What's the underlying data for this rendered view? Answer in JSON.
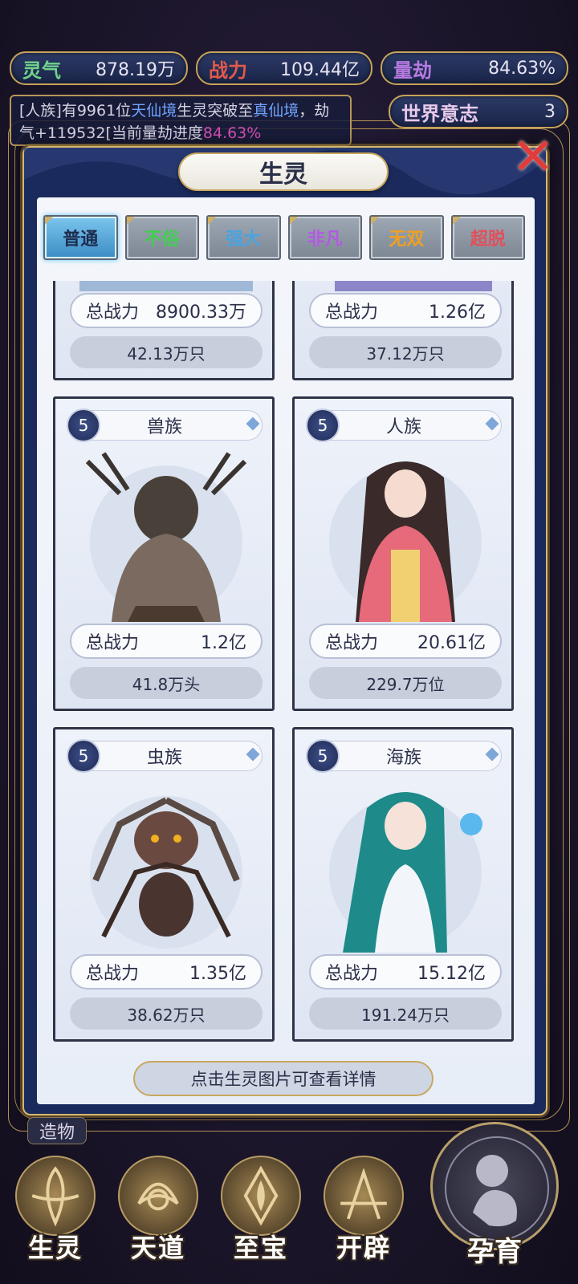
{
  "resources": {
    "qi": {
      "label": "灵气",
      "value": "878.19万"
    },
    "power": {
      "label": "战力",
      "value": "109.44亿"
    },
    "kalpa": {
      "label": "量劫",
      "value": "84.63%"
    },
    "world_will": {
      "label": "世界意志",
      "value": "3"
    }
  },
  "news": {
    "prefix": "[人族]有9961位",
    "realm": "天仙境",
    "middle": "生灵突破至",
    "target_realm": "真仙境",
    "suffix": "，劫气+119532[当前量劫进度",
    "progress": "84.63%"
  },
  "modal": {
    "title": "生灵",
    "close_icon": "close-x-icon",
    "tabs": [
      {
        "label": "普通",
        "color": "#1d2c4e",
        "active": true
      },
      {
        "label": "不俗",
        "color": "#3fcf4f",
        "active": false
      },
      {
        "label": "强大",
        "color": "#4aa3e0",
        "active": false
      },
      {
        "label": "非凡",
        "color": "#b35ae0",
        "active": false
      },
      {
        "label": "无双",
        "color": "#f0a020",
        "active": false
      },
      {
        "label": "超脱",
        "color": "#e0505a",
        "active": false
      }
    ],
    "power_label": "总战力",
    "cards": [
      {
        "name": "",
        "level": "",
        "power": "8900.33万",
        "population": "42.13万只"
      },
      {
        "name": "",
        "level": "",
        "power": "1.26亿",
        "population": "37.12万只"
      },
      {
        "name": "兽族",
        "level": "5",
        "power": "1.2亿",
        "population": "41.8万头"
      },
      {
        "name": "人族",
        "level": "5",
        "power": "20.61亿",
        "population": "229.7万位"
      },
      {
        "name": "虫族",
        "level": "5",
        "power": "1.35亿",
        "population": "38.62万只"
      },
      {
        "name": "海族",
        "level": "5",
        "power": "15.12亿",
        "population": "191.24万只"
      }
    ],
    "hint": "点击生灵图片可查看详情"
  },
  "bottom": {
    "creation_label": "造物",
    "nav": [
      {
        "label": "生灵",
        "icon": "creature-emblem-icon"
      },
      {
        "label": "天道",
        "icon": "heaven-way-emblem-icon"
      },
      {
        "label": "至宝",
        "icon": "treasure-emblem-icon"
      },
      {
        "label": "开辟",
        "icon": "open-world-emblem-icon"
      }
    ],
    "breed_label": "孕育"
  }
}
